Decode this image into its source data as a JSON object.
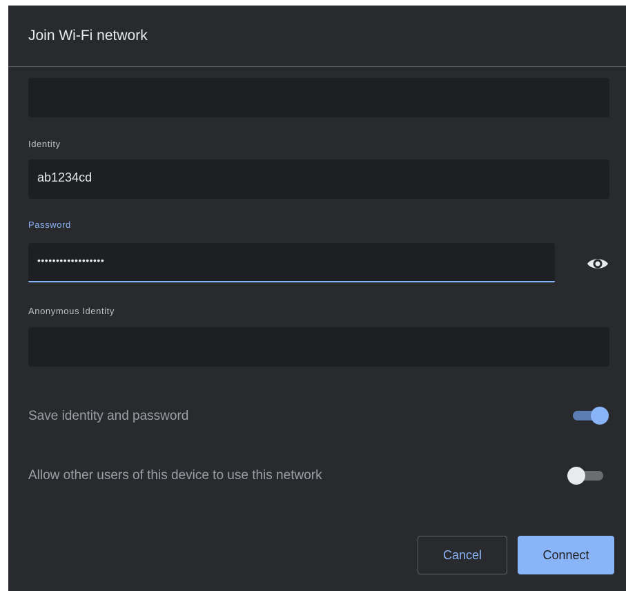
{
  "dialog": {
    "title": "Join Wi-Fi network"
  },
  "fields": {
    "identity": {
      "label": "Identity",
      "value": "ab1234cd"
    },
    "password": {
      "label": "Password",
      "value": "••••••••••••••••••",
      "visibility_icon": "eye-icon"
    },
    "anonymous_identity": {
      "label": "Anonymous Identity",
      "value": ""
    }
  },
  "toggles": {
    "save_identity": {
      "label": "Save identity and password",
      "state": "on"
    },
    "share_network": {
      "label": "Allow other users of this device to use this network",
      "state": "off"
    }
  },
  "buttons": {
    "cancel": "Cancel",
    "connect": "Connect"
  },
  "colors": {
    "dialog_background": "#292a2d",
    "field_background": "#1e1f22",
    "accent": "#8ab4f8",
    "text_primary": "#e8eaed",
    "text_secondary": "#9aa0a6"
  }
}
